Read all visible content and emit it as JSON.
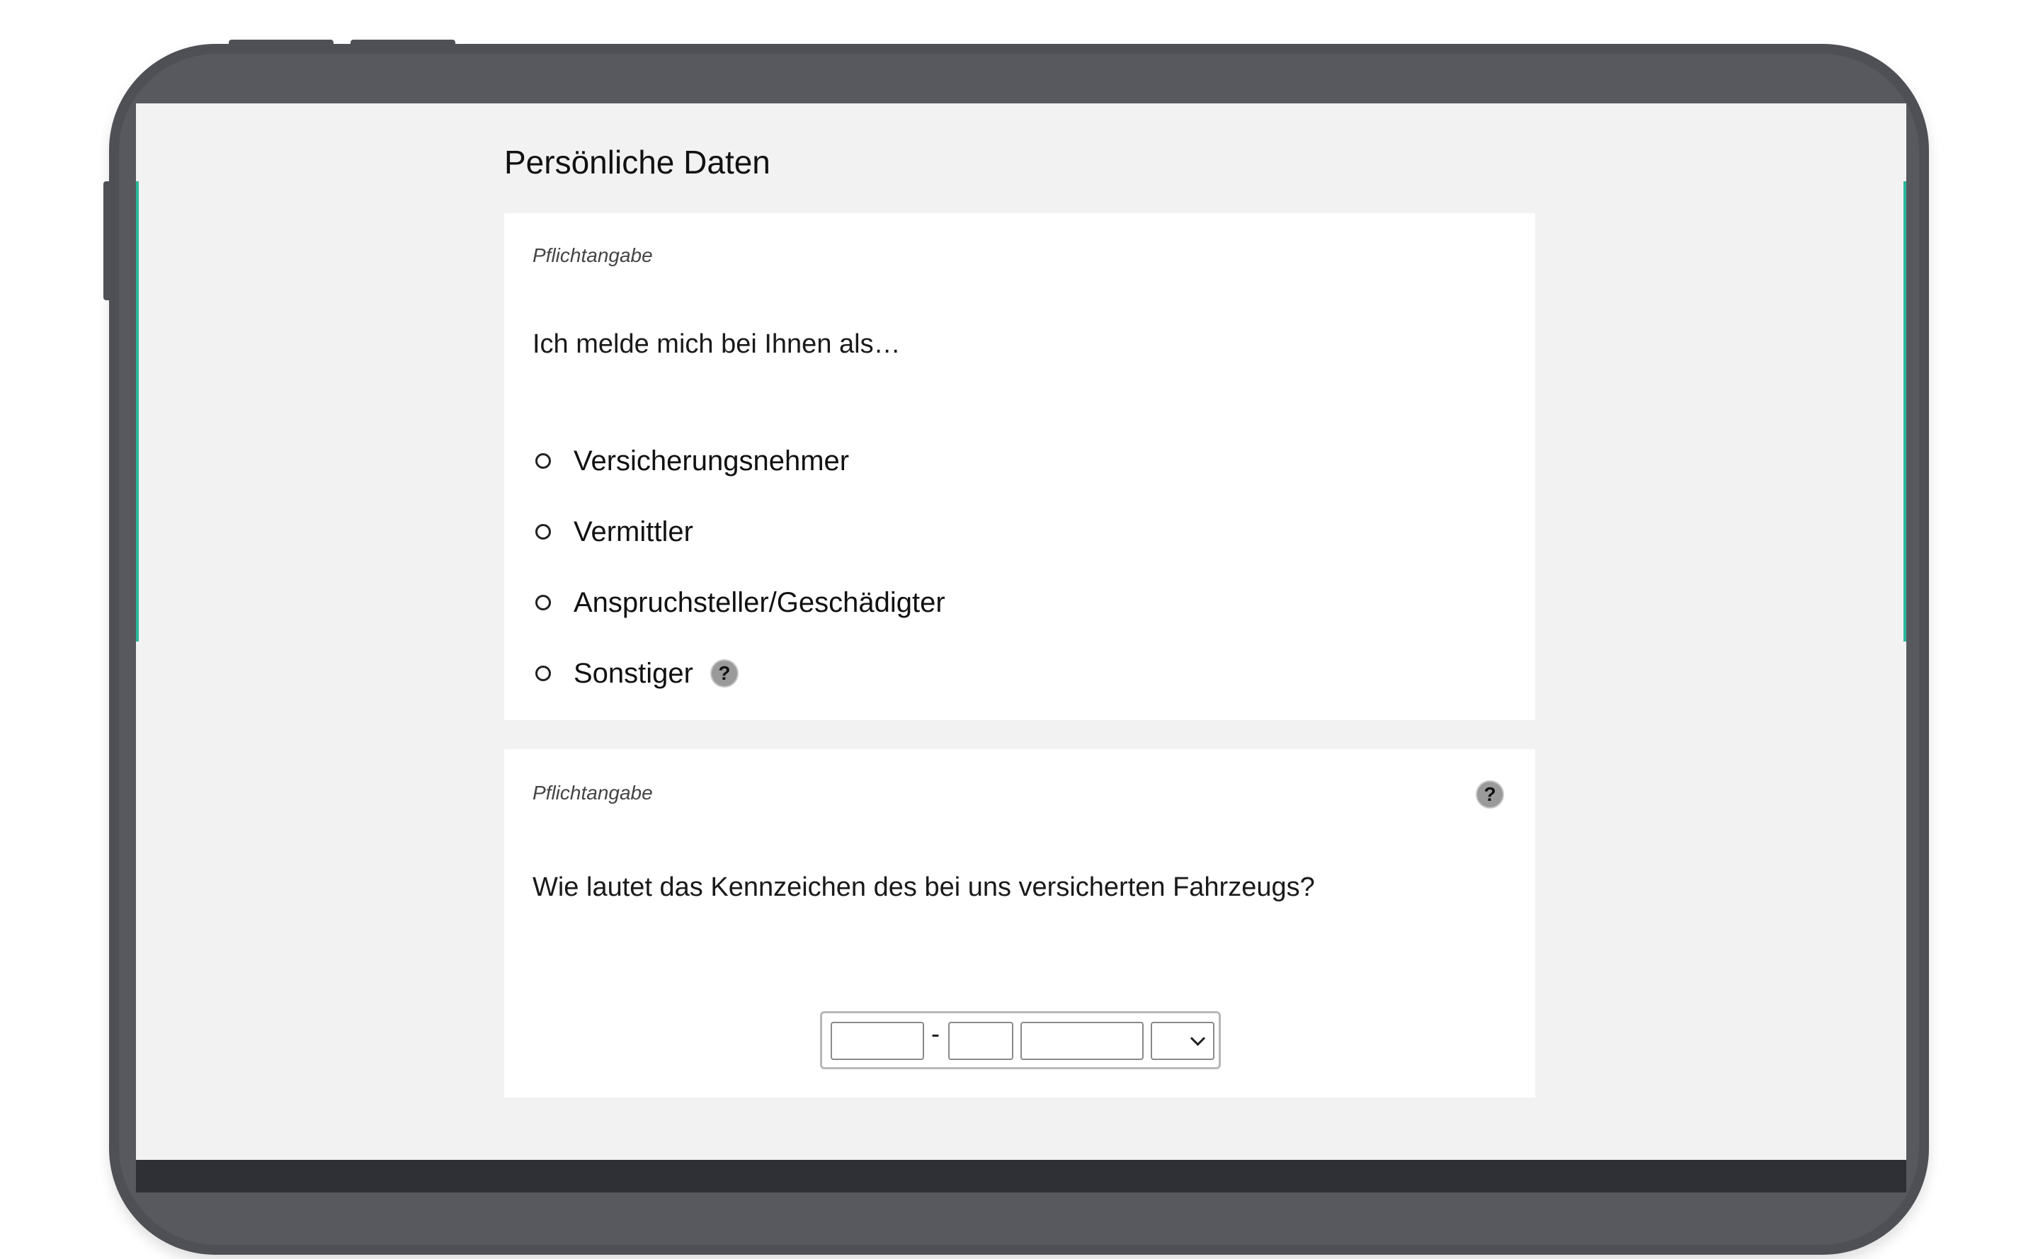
{
  "page": {
    "title": "Persönliche Daten"
  },
  "role_card": {
    "required_label": "Pflichtangabe",
    "question": "Ich melde mich bei Ihnen als…",
    "options": [
      {
        "label": "Versicherungsnehmer",
        "selected": false
      },
      {
        "label": "Vermittler",
        "selected": false
      },
      {
        "label": "Anspruchsteller/Geschädigter",
        "selected": false
      },
      {
        "label": "Sonstiger",
        "selected": false,
        "help_icon": "question-icon"
      }
    ],
    "help_symbol": "?"
  },
  "plate_card": {
    "required_label": "Pflichtangabe",
    "question": "Wie lautet das Kennzeichen des bei uns versicherten Fahrzeugs?",
    "help_symbol": "?",
    "plate": {
      "district_value": "",
      "separator": "-",
      "letters_value": "",
      "digits_value": "",
      "suffix_selected": ""
    }
  },
  "colors": {
    "screen_background": "#f2f2f2",
    "card_background": "#ffffff",
    "device_frame": "#4e5055",
    "accent": "#2bb89a"
  }
}
